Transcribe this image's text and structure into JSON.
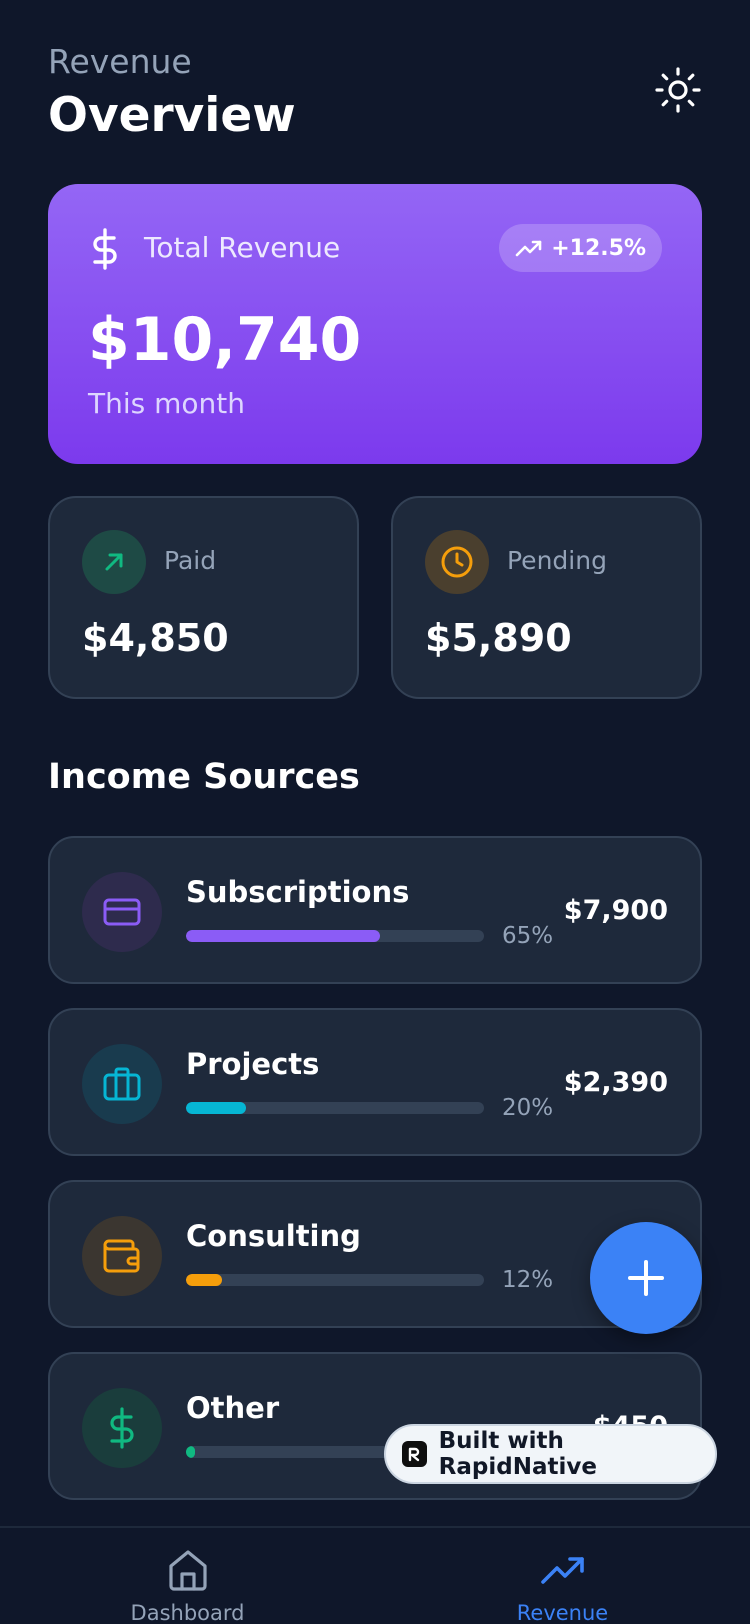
{
  "header": {
    "subtitle": "Revenue",
    "title": "Overview",
    "theme_icon": "sun-icon"
  },
  "hero": {
    "label": "Total Revenue",
    "icon": "dollar-icon",
    "badge": "+12.5%",
    "badge_icon": "trending-up-icon",
    "value": "$10,740",
    "period": "This month",
    "gradient": [
      "#9466f5",
      "#7c3aed"
    ]
  },
  "stats": {
    "paid": {
      "label": "Paid",
      "value": "$4,850",
      "icon": "arrow-up-right-icon",
      "color": "#10b981"
    },
    "pending": {
      "label": "Pending",
      "value": "$5,890",
      "icon": "clock-icon",
      "color": "#f59e0b"
    }
  },
  "income": {
    "title": "Income Sources",
    "sources": [
      {
        "name": "Subscriptions",
        "percent_label": "65%",
        "percent": 65,
        "amount": "$7,900",
        "icon": "credit-card-icon",
        "color": "#8b5cf6"
      },
      {
        "name": "Projects",
        "percent_label": "20%",
        "percent": 20,
        "amount": "$2,390",
        "icon": "briefcase-icon",
        "color": "#06b6d4"
      },
      {
        "name": "Consulting",
        "percent_label": "12%",
        "percent": 12,
        "amount": "$",
        "icon": "wallet-icon",
        "color": "#f59e0b"
      },
      {
        "name": "Other",
        "percent_label": "",
        "percent": 2,
        "amount": "$450",
        "icon": "dollar-icon",
        "color": "#10b981"
      }
    ]
  },
  "fab": {
    "icon": "plus-icon",
    "color": "#3b82f6"
  },
  "built_badge": {
    "label": "Built with RapidNative"
  },
  "tabs": [
    {
      "label": "Dashboard",
      "icon": "home-icon",
      "active": false
    },
    {
      "label": "Revenue",
      "icon": "trending-up-icon",
      "active": true
    }
  ]
}
